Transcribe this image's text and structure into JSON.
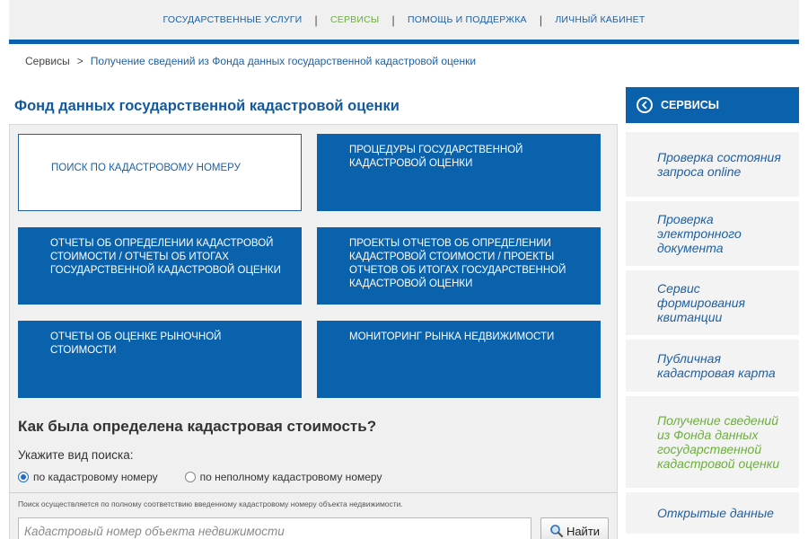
{
  "topnav": {
    "items": [
      {
        "label": "ГОСУДАРСТВЕННЫЕ УСЛУГИ",
        "active": false
      },
      {
        "label": "СЕРВИСЫ",
        "active": true
      },
      {
        "label": "ПОМОЩЬ И ПОДДЕРЖКА",
        "active": false
      },
      {
        "label": "ЛИЧНЫЙ КАБИНЕТ",
        "active": false
      }
    ],
    "separator": "|"
  },
  "breadcrumb": {
    "root": "Сервисы",
    "separator": ">",
    "current": "Получение сведений из Фонда данных государственной кадастровой оценки"
  },
  "page_title": "Фонд данных государственной кадастровой оценки",
  "tiles": [
    {
      "label": "ПОИСК ПО КАДАСТРОВОМУ НОМЕРУ"
    },
    {
      "label": "ПРОЦЕДУРЫ ГОСУДАРСТВЕННОЙ КАДАСТРОВОЙ ОЦЕНКИ"
    },
    {
      "label": "ОТЧЕТЫ ОБ ОПРЕДЕЛЕНИИ КАДАСТРОВОЙ СТОИМОСТИ / ОТЧЕТЫ ОБ ИТОГАХ ГОСУДАРСТВЕННОЙ КАДАСТРОВОЙ ОЦЕНКИ"
    },
    {
      "label": "ПРОЕКТЫ ОТЧЕТОВ ОБ ОПРЕДЕЛЕНИИ КАДАСТРОВОЙ СТОИМОСТИ / ПРОЕКТЫ ОТЧЕТОВ ОБ ИТОГАХ ГОСУДАРСТВЕННОЙ КАДАСТРОВОЙ ОЦЕНКИ"
    },
    {
      "label": "ОТЧЕТЫ ОБ ОЦЕНКЕ РЫНОЧНОЙ СТОИМОСТИ"
    },
    {
      "label": "МОНИТОРИНГ РЫНКА НЕДВИЖИМОСТИ"
    }
  ],
  "search": {
    "section_title": "Как была определена кадастровая стоимость?",
    "type_label": "Укажите вид поиска:",
    "options": [
      {
        "label": "по кадастровому номеру",
        "checked": true
      },
      {
        "label": "по неполному кадастровому номеру",
        "checked": false
      }
    ],
    "hint": "Поиск осуществляется по полному соответствию введенному кадастровому номеру объекта недвижимости.",
    "input_value": "",
    "placeholder": "Кадастровый номер объекта недвижимости",
    "button_label": "Найти",
    "button_icon": "magnifier-icon"
  },
  "sidebar": {
    "header": "СЕРВИСЫ",
    "header_icon": "chevron-left-circle-icon",
    "items": [
      {
        "label": "Проверка состояния запроса online",
        "active": false
      },
      {
        "label": "Проверка электронного документа",
        "active": false
      },
      {
        "label": "Сервис формирования квитанции",
        "active": false
      },
      {
        "label": "Публичная кадастровая карта",
        "active": false
      },
      {
        "label": "Получение сведений из Фонда данных государственной кадастровой оценки",
        "active": true
      },
      {
        "label": "Открытые данные",
        "active": false
      }
    ]
  },
  "colors": {
    "brand_blue": "#0a62ad",
    "link_blue": "#1f5f9f",
    "active_green": "#6dae3e",
    "panel_bg": "#f0f0f0"
  }
}
